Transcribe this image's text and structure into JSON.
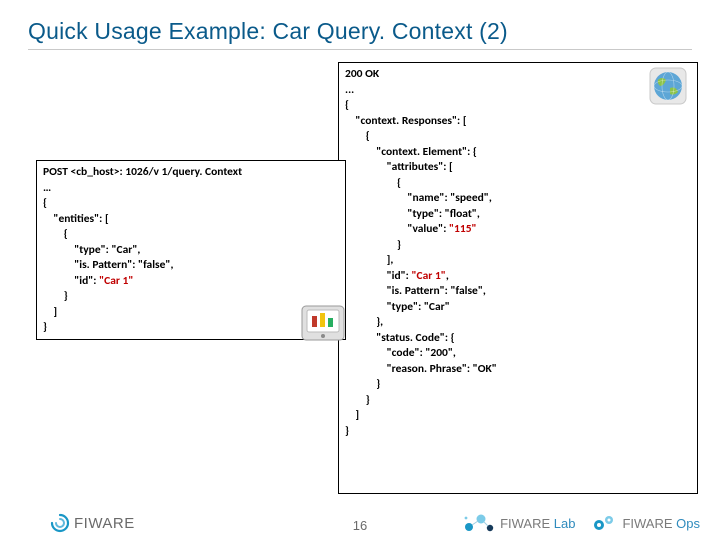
{
  "title": "Quick Usage Example: Car Query. Context (2)",
  "request": {
    "l1": "POST <cb_host>: 1026/v 1/query. Context",
    "l2": "…",
    "l3": "{",
    "l4": "    \"entities\": [",
    "l5": "        {",
    "l6": "            \"type\": \"Car\",",
    "l7": "            \"is. Pattern\": \"false\",",
    "l8a": "            \"id\": ",
    "l8b": "\"Car 1\"",
    "l9": "        }",
    "l10": "    ]",
    "l11": "}"
  },
  "response": {
    "l1": "200 OK",
    "l2": "...",
    "l3": "{",
    "l4": "    \"context. Responses\": [",
    "l5": "        {",
    "l6": "            \"context. Element\": {",
    "l7": "                \"attributes\": [",
    "l8": "                    {",
    "l9": "                        \"name\": \"speed\",",
    "l10": "                        \"type\": \"float\",",
    "l11a": "                        \"value\": ",
    "l11b": "\"115\"",
    "l12": "                    }",
    "l13": "                ],",
    "l14a": "                \"id\": ",
    "l14b": "\"Car 1\"",
    "l14c": ",",
    "l15": "                \"is. Pattern\": \"false\",",
    "l16": "                \"type\": \"Car\"",
    "l17": "            },",
    "l18": "            \"status. Code\": {",
    "l19": "                \"code\": \"200\",",
    "l20": "                \"reason. Phrase\": \"OK\"",
    "l21": "            }",
    "l22": "        }",
    "l23": "    ]",
    "l24": "}"
  },
  "page_number": "16",
  "footer": {
    "fiware": "FIWARE",
    "lab_prefix": "FIWARE ",
    "lab_suffix": "Lab",
    "ops_prefix": "FIWARE ",
    "ops_suffix": "Ops"
  }
}
